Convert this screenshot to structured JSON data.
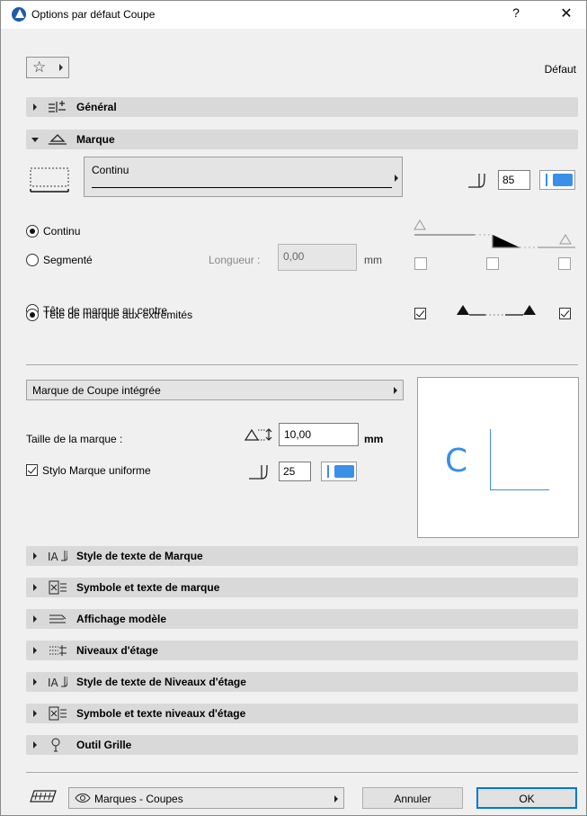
{
  "window": {
    "title": "Options par défaut Coupe",
    "help": "?",
    "close": "✕"
  },
  "toolbar": {
    "favorites_icon": "star-icon",
    "default_label": "Défaut"
  },
  "panels": {
    "general": {
      "label": "Général",
      "expanded": false
    },
    "marker": {
      "label": "Marque",
      "expanded": true
    }
  },
  "marker": {
    "line_type": "Continu",
    "pen_number": "85",
    "opt_continuous": "Continu",
    "opt_segmented": "Segmenté",
    "segmented_length_label": "Longueur :",
    "segmented_length_value": "0,00",
    "unit_mm": "mm",
    "opt_head_center": "Tête de marque au centre",
    "opt_head_ends": "Tête de marque aux extrémités",
    "selected_line": "Continu",
    "selected_head": "Tête de marque aux extrémités"
  },
  "marker_type": {
    "selected": "Marque de Coupe intégrée",
    "size_label": "Taille de la marque :",
    "size_value": "10,00",
    "size_unit": "mm",
    "uniform_pen_label": "Stylo Marque uniforme",
    "uniform_pen_checked": true,
    "pen_value": "25",
    "preview_letter": "C"
  },
  "collapsed_panels": [
    {
      "label": "Style de texte de Marque"
    },
    {
      "label": "Symbole et texte de marque"
    },
    {
      "label": "Affichage modèle"
    },
    {
      "label": "Niveaux d'étage"
    },
    {
      "label": "Style de texte de Niveaux d'étage"
    },
    {
      "label": "Symbole et texte niveaux d'étage"
    },
    {
      "label": "Outil Grille"
    }
  ],
  "footer": {
    "layer_label": "Marques - Coupes",
    "cancel": "Annuler",
    "ok": "OK"
  },
  "colors": {
    "accent": "#3a8fe6",
    "panel": "#d9d9d9",
    "window": "#f0f0f0"
  }
}
